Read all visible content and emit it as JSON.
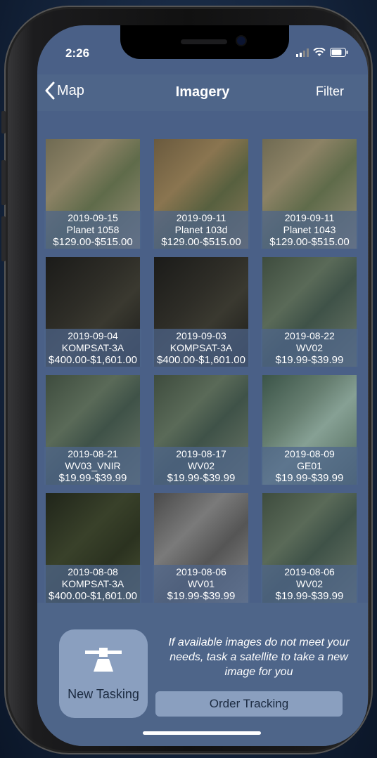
{
  "status": {
    "time": "2:26"
  },
  "nav": {
    "back_label": "Map",
    "title": "Imagery",
    "filter_label": "Filter"
  },
  "images": [
    {
      "date": "2019-09-15",
      "satellite": "Planet 1058",
      "price": "$129.00-$515.00",
      "tone": "urban-tan"
    },
    {
      "date": "2019-09-11",
      "satellite": "Planet 103d",
      "price": "$129.00-$515.00",
      "tone": "urban-brown"
    },
    {
      "date": "2019-09-11",
      "satellite": "Planet 1043",
      "price": "$129.00-$515.00",
      "tone": "urban-tan"
    },
    {
      "date": "2019-09-04",
      "satellite": "KOMPSAT-3A",
      "price": "$400.00-$1,601.00",
      "tone": "dark-city"
    },
    {
      "date": "2019-09-03",
      "satellite": "KOMPSAT-3A",
      "price": "$400.00-$1,601.00",
      "tone": "dark-city"
    },
    {
      "date": "2019-08-22",
      "satellite": "WV02",
      "price": "$19.99-$39.99",
      "tone": "green-water"
    },
    {
      "date": "2019-08-21",
      "satellite": "WV03_VNIR",
      "price": "$19.99-$39.99",
      "tone": "green-water"
    },
    {
      "date": "2019-08-17",
      "satellite": "WV02",
      "price": "$19.99-$39.99",
      "tone": "green-water"
    },
    {
      "date": "2019-08-09",
      "satellite": "GE01",
      "price": "$19.99-$39.99",
      "tone": "teal-cloud"
    },
    {
      "date": "2019-08-08",
      "satellite": "KOMPSAT-3A",
      "price": "$400.00-$1,601.00",
      "tone": "dark-forest"
    },
    {
      "date": "2019-08-06",
      "satellite": "WV01",
      "price": "$19.99-$39.99",
      "tone": "grayscale"
    },
    {
      "date": "2019-08-06",
      "satellite": "WV02",
      "price": "$19.99-$39.99",
      "tone": "green-water"
    }
  ],
  "tasking": {
    "button_label": "New Tasking",
    "button_icon": "satellite-icon",
    "message": "If available images do not meet your needs, task a satellite to take a new image for you",
    "order_label": "Order Tracking"
  }
}
